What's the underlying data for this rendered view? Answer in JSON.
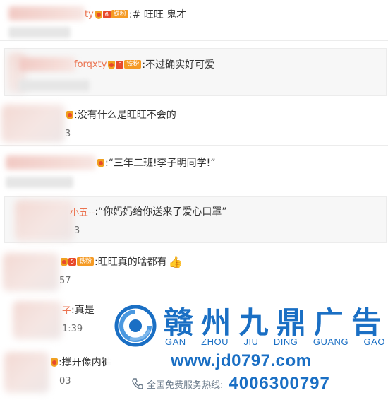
{
  "comments": [
    {
      "name_tail": "ty",
      "vip_level": "6",
      "vip_badge": "铁粉",
      "text": ":# 旺旺 鬼才",
      "time_tail": ""
    },
    {
      "name_tail": "forqxty",
      "vip_level": "6",
      "vip_badge": "铁粉",
      "text": ":不过确实好可爱",
      "time_tail": ""
    },
    {
      "name_tail": "",
      "vip_level": "",
      "vip_badge": "",
      "text": ":没有什么是旺旺不会的",
      "time_tail": "3"
    },
    {
      "name_tail": "",
      "vip_level": "",
      "vip_badge": "",
      "text": ":“三年二班!李子明同学!”",
      "time_tail": ""
    },
    {
      "name_tail": "小五--",
      "vip_level": "",
      "vip_badge": "",
      "text": ":“你妈妈给你送来了爱心口罩”",
      "time_tail": "3"
    },
    {
      "name_tail": "",
      "vip_level": "5",
      "vip_badge": "铁粉",
      "text": ":旺旺真的啥都有",
      "time_tail": "57",
      "emoji": "thumbs-up"
    },
    {
      "name_tail": "子",
      "vip_level": "",
      "vip_badge": "",
      "text": ":真是",
      "time_tail": "1:39"
    },
    {
      "name_tail": "",
      "vip_level": "",
      "vip_badge": "",
      "text": ":撑开像内裤",
      "time_tail": "03"
    }
  ],
  "ad": {
    "brand_chars": [
      "赣",
      "州",
      "九",
      "鼎",
      "广",
      "告"
    ],
    "pinyin": [
      "GAN",
      "ZHOU",
      "JIU",
      "DING",
      "GUANG",
      "GAO"
    ],
    "url": "www.jd0797.com",
    "hotline_label": "全国免费服务热线:",
    "hotline_number": "4006300797",
    "brand_color": "#1a6fc4"
  }
}
